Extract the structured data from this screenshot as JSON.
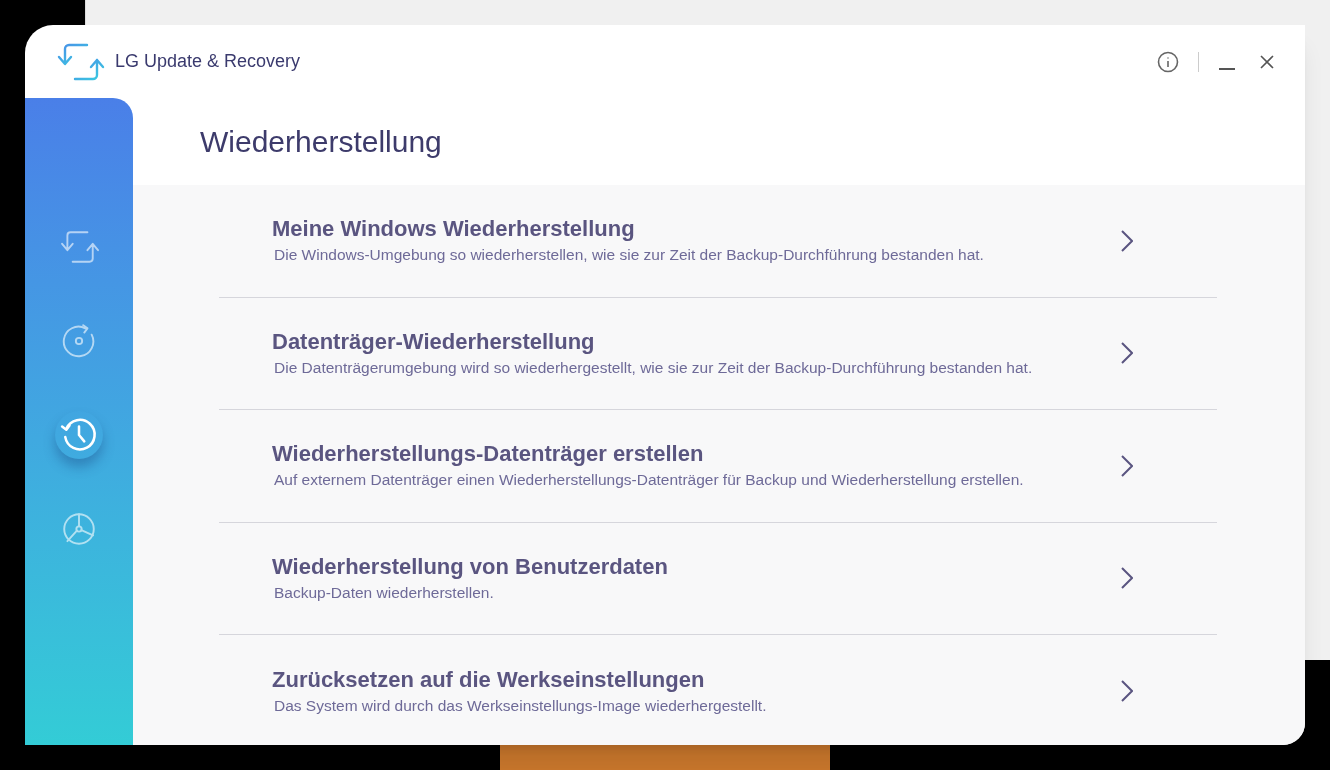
{
  "window": {
    "title": "LG Update & Recovery"
  },
  "sidebar": {
    "items": [
      {
        "selected": false
      },
      {
        "selected": false
      },
      {
        "selected": true
      },
      {
        "selected": false
      }
    ]
  },
  "page": {
    "title": "Wiederherstellung"
  },
  "options": [
    {
      "title": "Meine Windows Wiederherstellung",
      "description": "Die Windows-Umgebung so wiederherstellen, wie sie zur Zeit der Backup-Durchführung bestanden hat."
    },
    {
      "title": "Datenträger-Wiederherstellung",
      "description": "Die Datenträgerumgebung wird so wiederhergestellt, wie sie zur Zeit der Backup-Durchführung bestanden hat."
    },
    {
      "title": "Wiederherstellungs-Datenträger erstellen",
      "description": "Auf externem Datenträger einen Wiederherstellungs-Datenträger für Backup und Wiederherstellung erstellen."
    },
    {
      "title": "Wiederherstellung von Benutzerdaten",
      "description": "Backup-Daten wiederherstellen."
    },
    {
      "title": "Zurücksetzen auf die Werkseinstellungen",
      "description": "Das System wird durch das Werkseinstellungs-Image wiederhergestellt."
    }
  ]
}
